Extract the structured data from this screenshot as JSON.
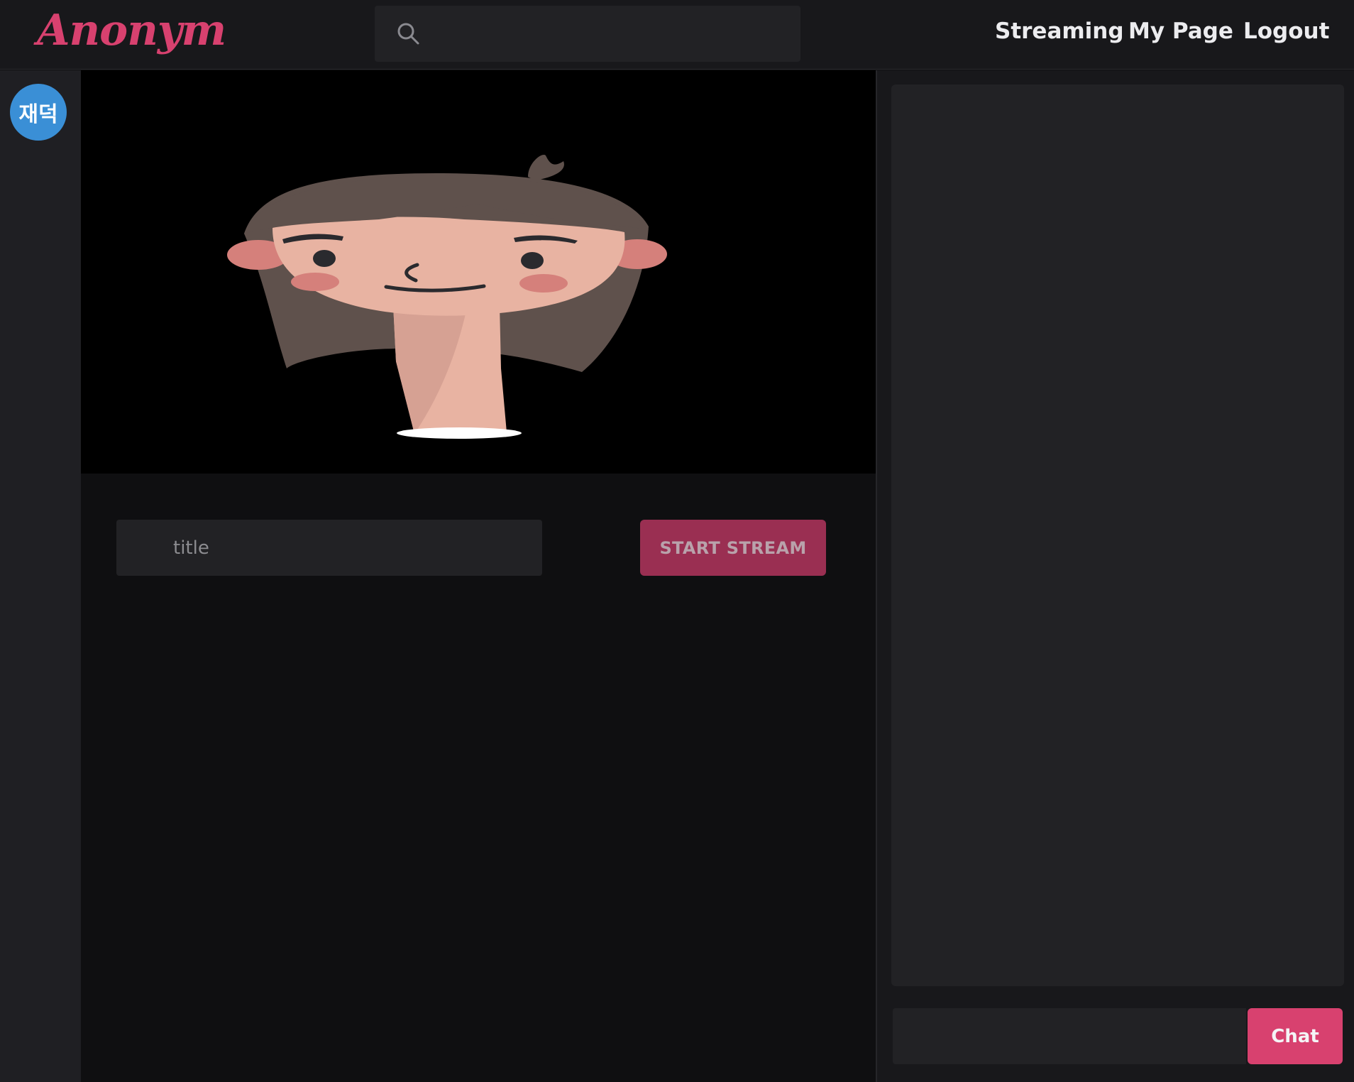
{
  "header": {
    "logo_text": "Anonym",
    "search": {
      "placeholder": "",
      "value": ""
    },
    "nav": {
      "streaming": "Streaming",
      "my_page": "My Page",
      "logout": "Logout"
    }
  },
  "sidebar": {
    "avatar_text": "재덕"
  },
  "stream_form": {
    "title_placeholder": "title",
    "start_button_label": "START STREAM"
  },
  "chat": {
    "input_placeholder": "",
    "send_button_label": "Chat"
  },
  "colors": {
    "accent": "#d8416f",
    "accent_dark": "#9a2f52",
    "avatar_bg": "#3a8fd6",
    "header_bg": "#18181b",
    "panel_bg": "#222225"
  }
}
